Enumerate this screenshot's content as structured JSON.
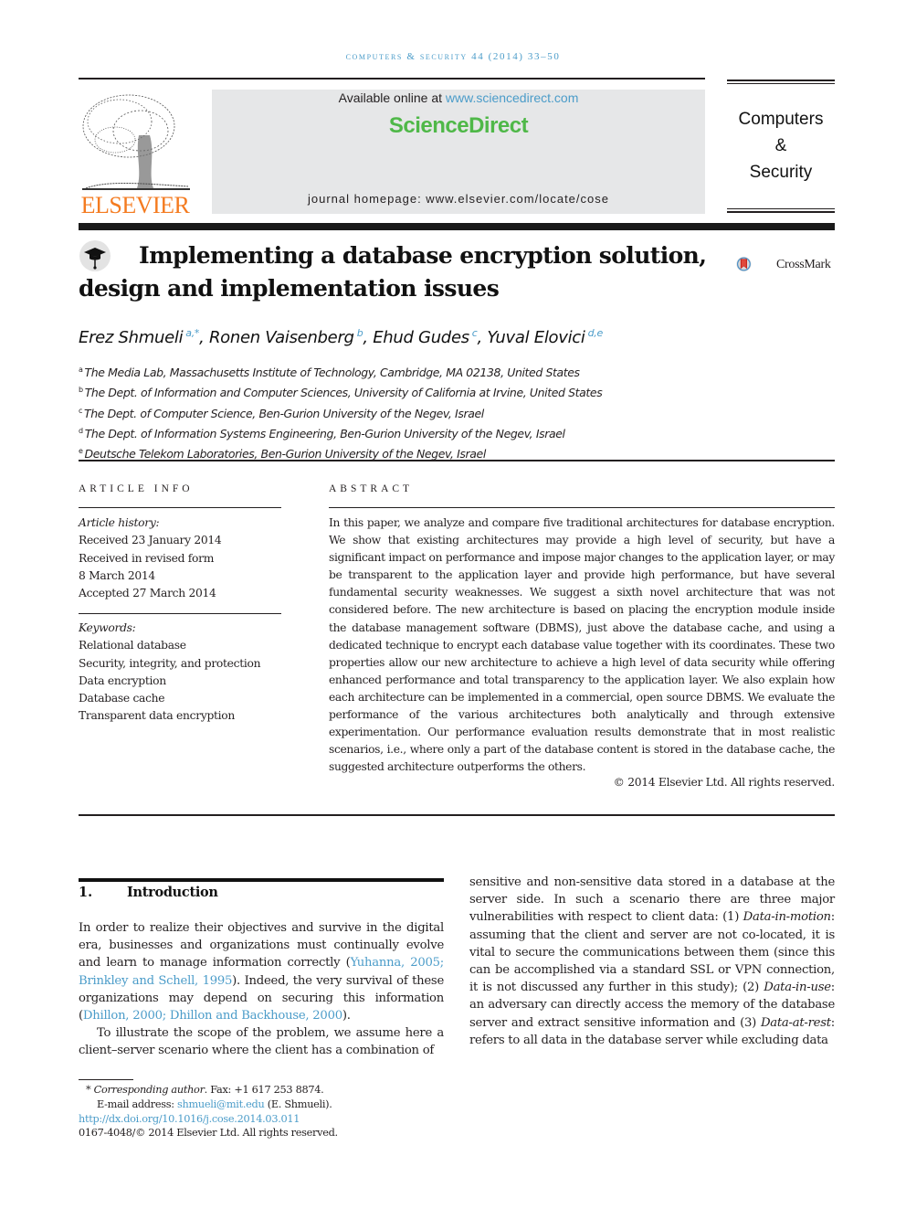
{
  "running_header": "computers & security 44 (2014) 33–50",
  "masthead": {
    "publisher_logo_text": "ELSEVIER",
    "available_online_prefix": "Available online at ",
    "available_online_link": "www.sciencedirect.com",
    "platform_name": "ScienceDirect",
    "journal_homepage": "journal homepage: www.elsevier.com/locate/cose",
    "journal_name_lines": [
      "Computers",
      "&",
      "Security"
    ],
    "colors": {
      "elsevier_orange": "#f47b20",
      "sciencedirect_green": "#4fb848",
      "link_blue": "#4b9cc9",
      "banner_gray": "#e6e7e8"
    }
  },
  "article": {
    "title_line1": "Implementing a database encryption solution,",
    "title_line2": "design and implementation issues",
    "crossmark_label": "CrossMark",
    "authors": [
      {
        "name": "Erez Shmueli",
        "sup": "a,*"
      },
      {
        "name": "Ronen Vaisenberg",
        "sup": "b"
      },
      {
        "name": "Ehud Gudes",
        "sup": "c"
      },
      {
        "name": "Yuval Elovici",
        "sup": "d,e"
      }
    ],
    "affiliations": [
      {
        "key": "a",
        "text": "The Media Lab, Massachusetts Institute of Technology, Cambridge, MA 02138, United States"
      },
      {
        "key": "b",
        "text": "The Dept. of Information and Computer Sciences, University of California at Irvine, United States"
      },
      {
        "key": "c",
        "text": "The Dept. of Computer Science, Ben-Gurion University of the Negev, Israel"
      },
      {
        "key": "d",
        "text": "The Dept. of Information Systems Engineering, Ben-Gurion University of the Negev, Israel"
      },
      {
        "key": "e",
        "text": "Deutsche Telekom Laboratories, Ben-Gurion University of the Negev, Israel"
      }
    ]
  },
  "article_info": {
    "heading": "ARTICLE INFO",
    "history_label": "Article history:",
    "history": [
      "Received 23 January 2014",
      "Received in revised form",
      "8 March 2014",
      "Accepted 27 March 2014"
    ],
    "keywords_label": "Keywords:",
    "keywords": [
      "Relational database",
      "Security, integrity, and protection",
      "Data encryption",
      "Database cache",
      "Transparent data encryption"
    ]
  },
  "abstract": {
    "heading": "ABSTRACT",
    "text": "In this paper, we analyze and compare five traditional architectures for database encryption. We show that existing architectures may provide a high level of security, but have a significant impact on performance and impose major changes to the application layer, or may be transparent to the application layer and provide high performance, but have several fundamental security weaknesses. We suggest a sixth novel architecture that was not considered before. The new architecture is based on placing the encryption module inside the database management software (DBMS), just above the database cache, and using a dedicated technique to encrypt each database value together with its coordinates. These two properties allow our new architecture to achieve a high level of data security while offering enhanced performance and total transparency to the application layer. We also explain how each architecture can be implemented in a commercial, open source DBMS. We evaluate the performance of the various architectures both analytically and through extensive experimentation. Our performance evaluation results demonstrate that in most realistic scenarios, i.e., where only a part of the database content is stored in the database cache, the suggested architecture outperforms the others.",
    "copyright": "© 2014 Elsevier Ltd. All rights reserved."
  },
  "body": {
    "section_number": "1.",
    "section_title": "Introduction",
    "para1": {
      "t1": "In order to realize their objectives and survive in the digital era, businesses and organizations must continually evolve and learn to manage information correctly (",
      "c1": "Yuhanna, 2005; Brinkley and Schell, 1995",
      "t2": "). Indeed, the very survival of these organizations may depend on securing this information (",
      "c2": "Dhillon, 2000; Dhillon and Backhouse, 2000",
      "t3": ")."
    },
    "para2_left": "To illustrate the scope of the problem, we assume here a client–server scenario where the client has a combination of",
    "right": {
      "t1": "sensitive and non-sensitive data stored in a database at the server side. In such a scenario there are three major vulnerabilities with respect to client data: (1) ",
      "term1": "Data-in-motion",
      "t2": ": assuming that the client and server are not co-located, it is vital to secure the communications between them (since this can be accomplished via a standard SSL or VPN connection, it is not discussed any further in this study); (2) ",
      "term2": "Data-in-use",
      "t3": ": an adversary can directly access the memory of the database server and extract sensitive information and (3) ",
      "term3": "Data-at-rest",
      "t4": ": refers to all data in the database server while excluding data"
    }
  },
  "footnotes": {
    "star": "*",
    "corresponding_label": "Corresponding author",
    "fax": ". Fax: +1 617 253 8874.",
    "email_label": "E-mail address: ",
    "email": "shmueli@mit.edu",
    "email_suffix": " (E. Shmueli).",
    "doi": "http://dx.doi.org/10.1016/j.cose.2014.03.011",
    "issn_copyright": "0167-4048/© 2014 Elsevier Ltd. All rights reserved."
  }
}
